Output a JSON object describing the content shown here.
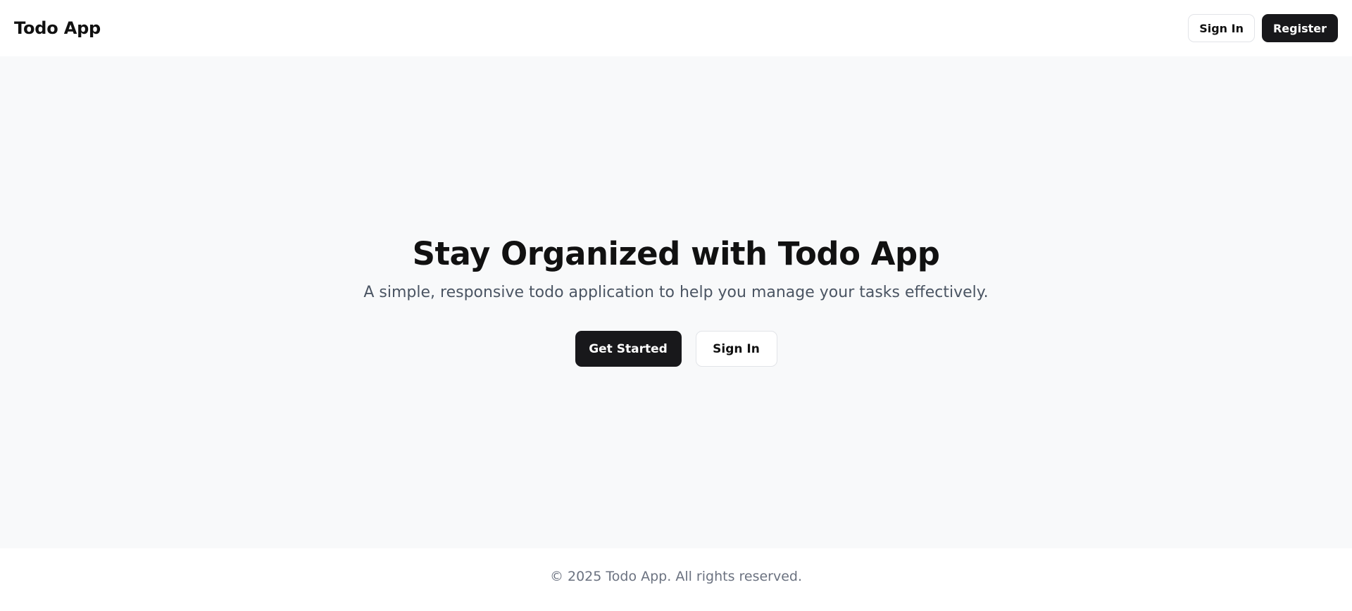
{
  "header": {
    "brand": "Todo App",
    "signin_label": "Sign In",
    "register_label": "Register"
  },
  "hero": {
    "title": "Stay Organized with Todo App",
    "subtitle": "A simple, responsive todo application to help you manage your tasks effectively.",
    "get_started_label": "Get Started",
    "signin_label": "Sign In"
  },
  "footer": {
    "copyright": "© 2025 Todo App. All rights reserved."
  },
  "colors": {
    "primary": "#18181b",
    "page_background": "#f8f9fa",
    "muted_text": "#6b7280",
    "subtitle_text": "#4b5563"
  }
}
